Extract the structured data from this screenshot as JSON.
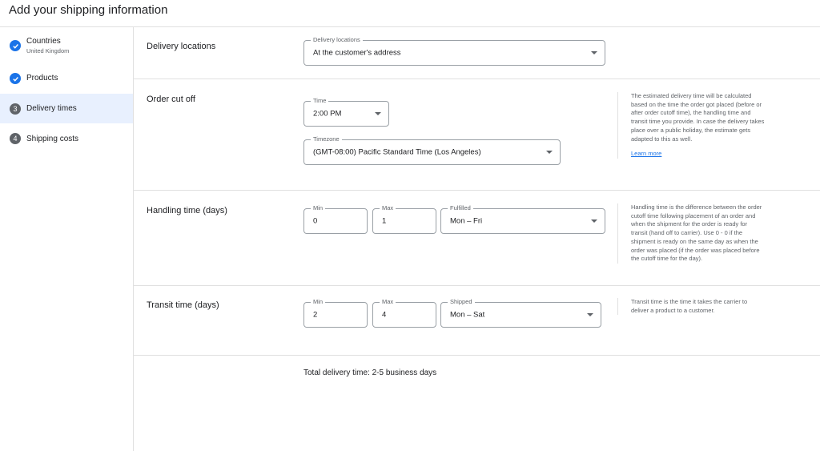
{
  "page": {
    "title": "Add your shipping information"
  },
  "sidebar": {
    "steps": [
      {
        "label": "Countries",
        "sub": "United Kingdom",
        "state": "done"
      },
      {
        "label": "Products",
        "sub": "",
        "state": "done"
      },
      {
        "label": "Delivery times",
        "sub": "",
        "state": "active",
        "number": "3"
      },
      {
        "label": "Shipping costs",
        "sub": "",
        "state": "todo",
        "number": "4"
      }
    ]
  },
  "delivery_locations": {
    "title": "Delivery locations",
    "field_label": "Delivery locations",
    "value": "At the customer's address"
  },
  "order_cutoff": {
    "title": "Order cut off",
    "time_label": "Time",
    "time_value": "2:00 PM",
    "timezone_label": "Timezone",
    "timezone_value": "(GMT-08:00) Pacific Standard Time (Los Angeles)",
    "help": "The estimated delivery time will be calculated based on the time the order got placed (before or after order cutoff time), the handling time and transit time you provide. In case the delivery takes place over a public holiday, the estimate gets adapted to this as well.",
    "learn_more": "Learn more"
  },
  "handling_time": {
    "title": "Handling time (days)",
    "min_label": "Min",
    "min_value": "0",
    "max_label": "Max",
    "max_value": "1",
    "fulfilled_label": "Fulfilled",
    "fulfilled_value": "Mon – Fri",
    "help": "Handling time is the difference between the order cutoff time following placement of an order and when the shipment for the order is ready for transit (hand off to carrier). Use 0 - 0 if the shipment is ready on the same day as when the order was placed (if the order was placed before the cutoff time for the day)."
  },
  "transit_time": {
    "title": "Transit time (days)",
    "min_label": "Min",
    "min_value": "2",
    "max_label": "Max",
    "max_value": "4",
    "shipped_label": "Shipped",
    "shipped_value": "Mon – Sat",
    "help": "Transit time is the time it takes the carrier to deliver a product to a customer."
  },
  "total": {
    "text": "Total delivery time: 2-5 business days"
  },
  "colors": {
    "accent": "#1a73e8",
    "active_bg": "#e8f0fe",
    "step_number": "#5f6368"
  }
}
